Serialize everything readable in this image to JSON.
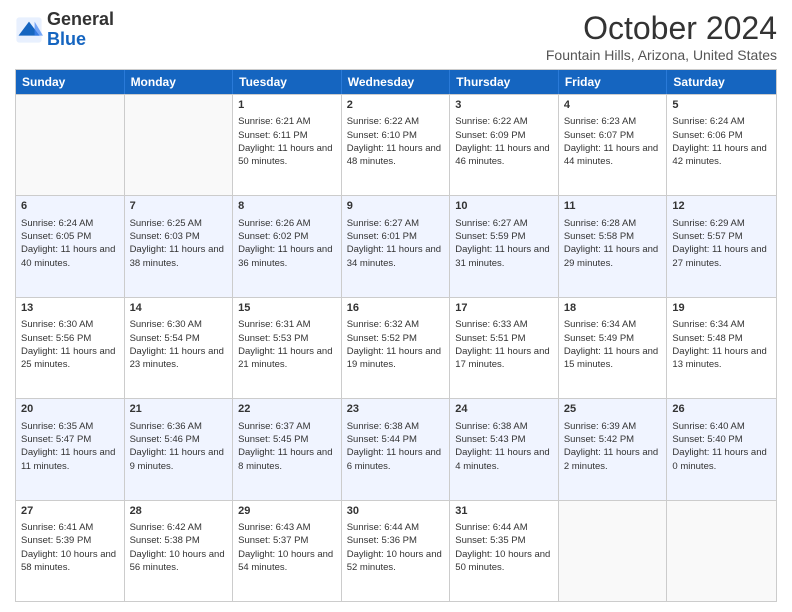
{
  "header": {
    "logo_general": "General",
    "logo_blue": "Blue",
    "month": "October 2024",
    "location": "Fountain Hills, Arizona, United States"
  },
  "days_of_week": [
    "Sunday",
    "Monday",
    "Tuesday",
    "Wednesday",
    "Thursday",
    "Friday",
    "Saturday"
  ],
  "weeks": [
    [
      {
        "day": "",
        "sunrise": "",
        "sunset": "",
        "daylight": "",
        "empty": true
      },
      {
        "day": "",
        "sunrise": "",
        "sunset": "",
        "daylight": "",
        "empty": true
      },
      {
        "day": "1",
        "sunrise": "Sunrise: 6:21 AM",
        "sunset": "Sunset: 6:11 PM",
        "daylight": "Daylight: 11 hours and 50 minutes.",
        "empty": false
      },
      {
        "day": "2",
        "sunrise": "Sunrise: 6:22 AM",
        "sunset": "Sunset: 6:10 PM",
        "daylight": "Daylight: 11 hours and 48 minutes.",
        "empty": false
      },
      {
        "day": "3",
        "sunrise": "Sunrise: 6:22 AM",
        "sunset": "Sunset: 6:09 PM",
        "daylight": "Daylight: 11 hours and 46 minutes.",
        "empty": false
      },
      {
        "day": "4",
        "sunrise": "Sunrise: 6:23 AM",
        "sunset": "Sunset: 6:07 PM",
        "daylight": "Daylight: 11 hours and 44 minutes.",
        "empty": false
      },
      {
        "day": "5",
        "sunrise": "Sunrise: 6:24 AM",
        "sunset": "Sunset: 6:06 PM",
        "daylight": "Daylight: 11 hours and 42 minutes.",
        "empty": false
      }
    ],
    [
      {
        "day": "6",
        "sunrise": "Sunrise: 6:24 AM",
        "sunset": "Sunset: 6:05 PM",
        "daylight": "Daylight: 11 hours and 40 minutes.",
        "empty": false
      },
      {
        "day": "7",
        "sunrise": "Sunrise: 6:25 AM",
        "sunset": "Sunset: 6:03 PM",
        "daylight": "Daylight: 11 hours and 38 minutes.",
        "empty": false
      },
      {
        "day": "8",
        "sunrise": "Sunrise: 6:26 AM",
        "sunset": "Sunset: 6:02 PM",
        "daylight": "Daylight: 11 hours and 36 minutes.",
        "empty": false
      },
      {
        "day": "9",
        "sunrise": "Sunrise: 6:27 AM",
        "sunset": "Sunset: 6:01 PM",
        "daylight": "Daylight: 11 hours and 34 minutes.",
        "empty": false
      },
      {
        "day": "10",
        "sunrise": "Sunrise: 6:27 AM",
        "sunset": "Sunset: 5:59 PM",
        "daylight": "Daylight: 11 hours and 31 minutes.",
        "empty": false
      },
      {
        "day": "11",
        "sunrise": "Sunrise: 6:28 AM",
        "sunset": "Sunset: 5:58 PM",
        "daylight": "Daylight: 11 hours and 29 minutes.",
        "empty": false
      },
      {
        "day": "12",
        "sunrise": "Sunrise: 6:29 AM",
        "sunset": "Sunset: 5:57 PM",
        "daylight": "Daylight: 11 hours and 27 minutes.",
        "empty": false
      }
    ],
    [
      {
        "day": "13",
        "sunrise": "Sunrise: 6:30 AM",
        "sunset": "Sunset: 5:56 PM",
        "daylight": "Daylight: 11 hours and 25 minutes.",
        "empty": false
      },
      {
        "day": "14",
        "sunrise": "Sunrise: 6:30 AM",
        "sunset": "Sunset: 5:54 PM",
        "daylight": "Daylight: 11 hours and 23 minutes.",
        "empty": false
      },
      {
        "day": "15",
        "sunrise": "Sunrise: 6:31 AM",
        "sunset": "Sunset: 5:53 PM",
        "daylight": "Daylight: 11 hours and 21 minutes.",
        "empty": false
      },
      {
        "day": "16",
        "sunrise": "Sunrise: 6:32 AM",
        "sunset": "Sunset: 5:52 PM",
        "daylight": "Daylight: 11 hours and 19 minutes.",
        "empty": false
      },
      {
        "day": "17",
        "sunrise": "Sunrise: 6:33 AM",
        "sunset": "Sunset: 5:51 PM",
        "daylight": "Daylight: 11 hours and 17 minutes.",
        "empty": false
      },
      {
        "day": "18",
        "sunrise": "Sunrise: 6:34 AM",
        "sunset": "Sunset: 5:49 PM",
        "daylight": "Daylight: 11 hours and 15 minutes.",
        "empty": false
      },
      {
        "day": "19",
        "sunrise": "Sunrise: 6:34 AM",
        "sunset": "Sunset: 5:48 PM",
        "daylight": "Daylight: 11 hours and 13 minutes.",
        "empty": false
      }
    ],
    [
      {
        "day": "20",
        "sunrise": "Sunrise: 6:35 AM",
        "sunset": "Sunset: 5:47 PM",
        "daylight": "Daylight: 11 hours and 11 minutes.",
        "empty": false
      },
      {
        "day": "21",
        "sunrise": "Sunrise: 6:36 AM",
        "sunset": "Sunset: 5:46 PM",
        "daylight": "Daylight: 11 hours and 9 minutes.",
        "empty": false
      },
      {
        "day": "22",
        "sunrise": "Sunrise: 6:37 AM",
        "sunset": "Sunset: 5:45 PM",
        "daylight": "Daylight: 11 hours and 8 minutes.",
        "empty": false
      },
      {
        "day": "23",
        "sunrise": "Sunrise: 6:38 AM",
        "sunset": "Sunset: 5:44 PM",
        "daylight": "Daylight: 11 hours and 6 minutes.",
        "empty": false
      },
      {
        "day": "24",
        "sunrise": "Sunrise: 6:38 AM",
        "sunset": "Sunset: 5:43 PM",
        "daylight": "Daylight: 11 hours and 4 minutes.",
        "empty": false
      },
      {
        "day": "25",
        "sunrise": "Sunrise: 6:39 AM",
        "sunset": "Sunset: 5:42 PM",
        "daylight": "Daylight: 11 hours and 2 minutes.",
        "empty": false
      },
      {
        "day": "26",
        "sunrise": "Sunrise: 6:40 AM",
        "sunset": "Sunset: 5:40 PM",
        "daylight": "Daylight: 11 hours and 0 minutes.",
        "empty": false
      }
    ],
    [
      {
        "day": "27",
        "sunrise": "Sunrise: 6:41 AM",
        "sunset": "Sunset: 5:39 PM",
        "daylight": "Daylight: 10 hours and 58 minutes.",
        "empty": false
      },
      {
        "day": "28",
        "sunrise": "Sunrise: 6:42 AM",
        "sunset": "Sunset: 5:38 PM",
        "daylight": "Daylight: 10 hours and 56 minutes.",
        "empty": false
      },
      {
        "day": "29",
        "sunrise": "Sunrise: 6:43 AM",
        "sunset": "Sunset: 5:37 PM",
        "daylight": "Daylight: 10 hours and 54 minutes.",
        "empty": false
      },
      {
        "day": "30",
        "sunrise": "Sunrise: 6:44 AM",
        "sunset": "Sunset: 5:36 PM",
        "daylight": "Daylight: 10 hours and 52 minutes.",
        "empty": false
      },
      {
        "day": "31",
        "sunrise": "Sunrise: 6:44 AM",
        "sunset": "Sunset: 5:35 PM",
        "daylight": "Daylight: 10 hours and 50 minutes.",
        "empty": false
      },
      {
        "day": "",
        "sunrise": "",
        "sunset": "",
        "daylight": "",
        "empty": true
      },
      {
        "day": "",
        "sunrise": "",
        "sunset": "",
        "daylight": "",
        "empty": true
      }
    ]
  ]
}
